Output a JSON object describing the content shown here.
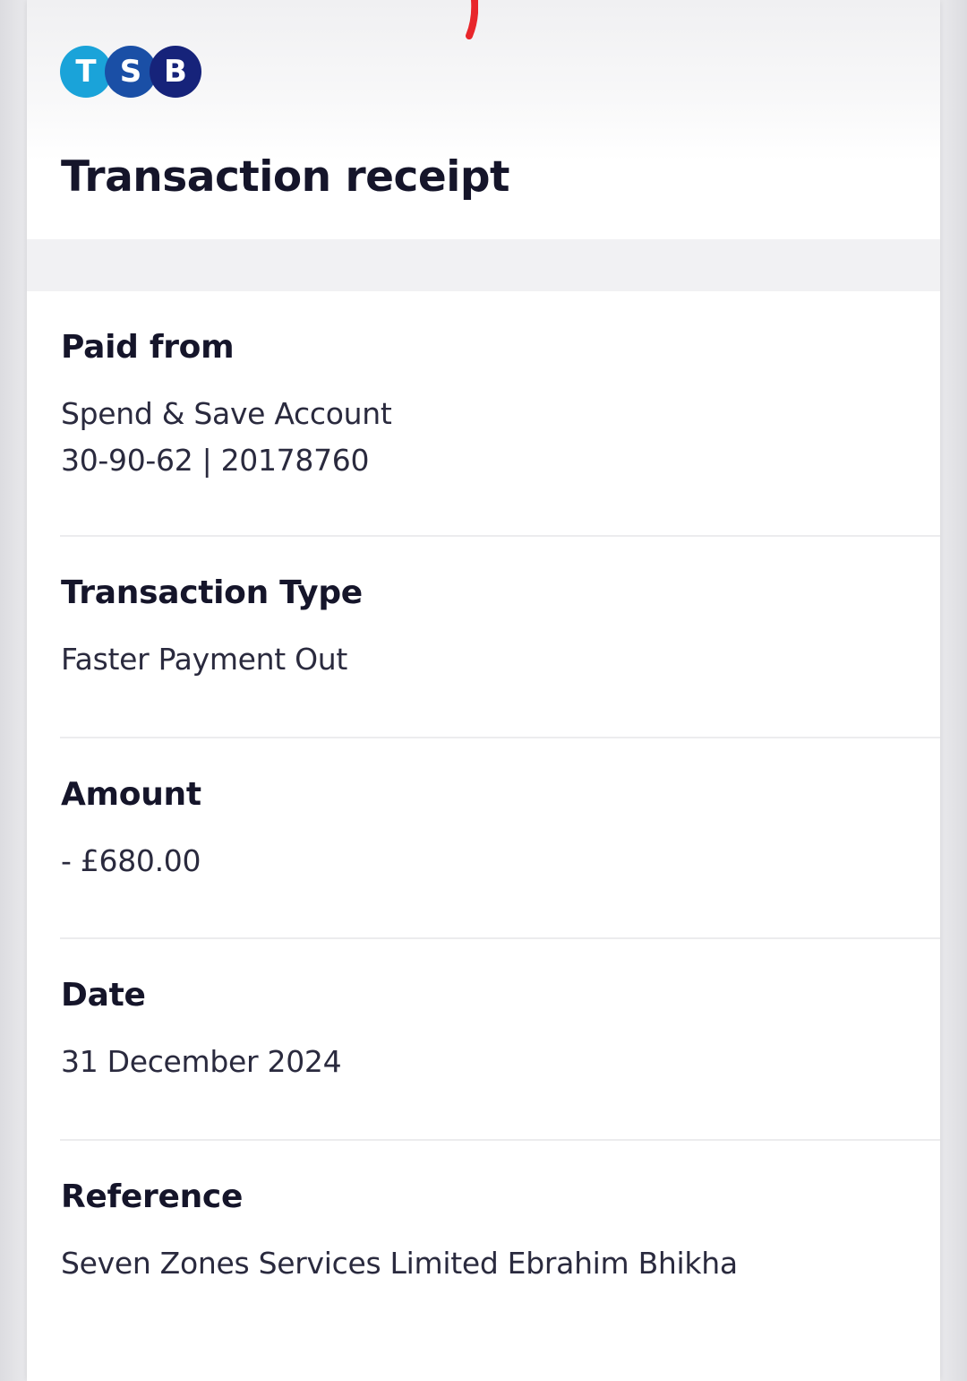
{
  "brand": {
    "logo_letters": [
      "T",
      "S",
      "B"
    ],
    "logo_colors": [
      "#1aa3d9",
      "#1a4fa6",
      "#16237a"
    ]
  },
  "receipt": {
    "title": "Transaction receipt",
    "paid_from": {
      "label": "Paid from",
      "account_name": "Spend & Save Account",
      "account_number": "30-90-62 | 20178760"
    },
    "transaction_type": {
      "label": "Transaction Type",
      "value": "Faster Payment Out"
    },
    "amount": {
      "label": "Amount",
      "value": "- £680.00"
    },
    "date": {
      "label": "Date",
      "value": "31 December 2024"
    },
    "reference": {
      "label": "Reference",
      "value": "Seven Zones Services Limited Ebrahim Bhikha"
    }
  },
  "colors": {
    "text_primary": "#15152a",
    "text_secondary": "#2a2a3e",
    "annotation_mark": "#e8262b"
  }
}
